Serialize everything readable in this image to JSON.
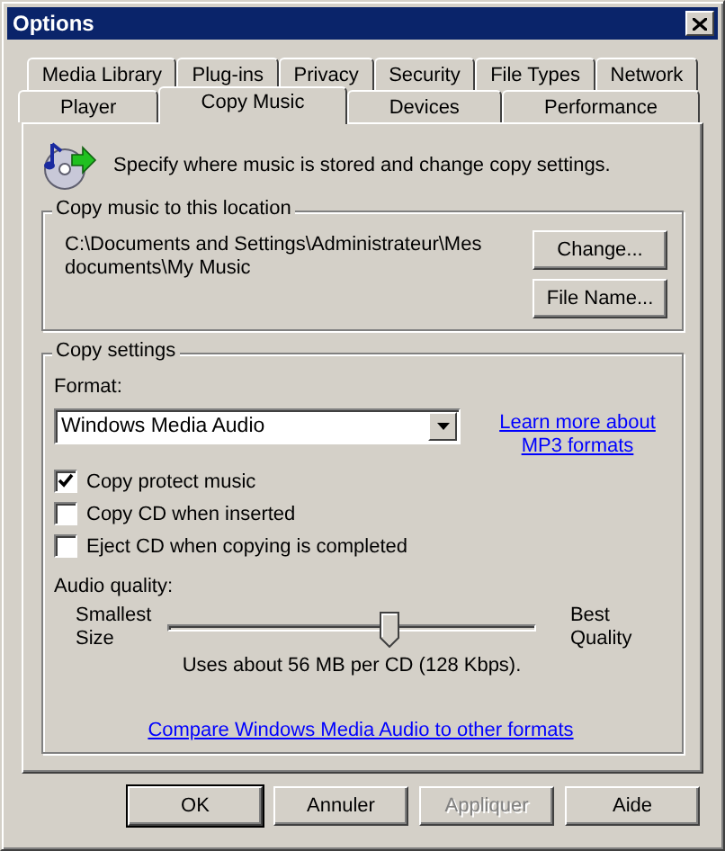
{
  "window": {
    "title": "Options"
  },
  "tab_rows": [
    [
      {
        "label": "Media Library",
        "selected": false
      },
      {
        "label": "Plug-ins",
        "selected": false
      },
      {
        "label": "Privacy",
        "selected": false
      },
      {
        "label": "Security",
        "selected": false
      },
      {
        "label": "File Types",
        "selected": false
      },
      {
        "label": "Network",
        "selected": false
      }
    ],
    [
      {
        "label": "Player",
        "selected": false
      },
      {
        "label": "Copy Music",
        "selected": true
      },
      {
        "label": "Devices",
        "selected": false
      },
      {
        "label": "Performance",
        "selected": false
      }
    ]
  ],
  "header": {
    "text": "Specify where music is stored and change copy settings."
  },
  "location": {
    "legend": "Copy music to this location",
    "path": "C:\\Documents and Settings\\Administrateur\\Mes documents\\My Music",
    "buttons": [
      "Change...",
      "File Name..."
    ]
  },
  "copy_settings": {
    "legend": "Copy settings",
    "format_label": "Format:",
    "format_value": "Windows Media Audio",
    "learn_link": "Learn more about MP3 formats",
    "options": [
      {
        "label": "Copy protect music",
        "checked": true
      },
      {
        "label": "Copy CD when inserted",
        "checked": false
      },
      {
        "label": "Eject CD when copying is completed",
        "checked": false
      }
    ],
    "quality_label": "Audio quality:",
    "min_label": "Smallest Size",
    "max_label": "Best Quality",
    "level": 0.6,
    "reading": "Uses about 56 MB per CD (128 Kbps).",
    "compare_link": "Compare Windows Media Audio to other formats"
  },
  "buttons": [
    {
      "label": "OK",
      "default": true,
      "disabled": false
    },
    {
      "label": "Annuler",
      "default": false,
      "disabled": false
    },
    {
      "label": "Appliquer",
      "default": false,
      "disabled": true
    },
    {
      "label": "Aide",
      "default": false,
      "disabled": false
    }
  ]
}
